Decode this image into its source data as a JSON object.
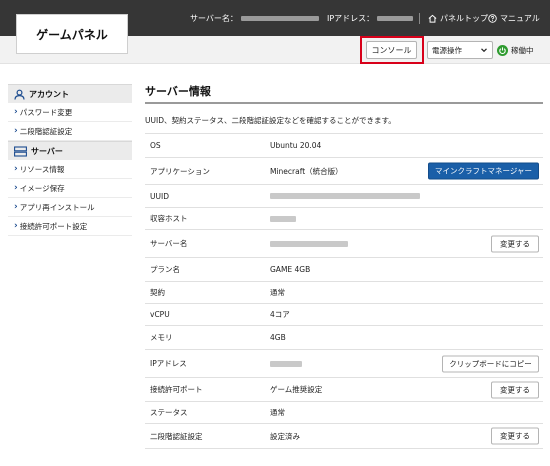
{
  "header": {
    "logo": "ゲームパネル",
    "server_name_label": "サーバー名：",
    "ip_label": "IPアドレス：",
    "panel_top": "パネルトップ",
    "manual": "マニュアル"
  },
  "toolbar": {
    "console_label": "コンソール",
    "power_select_value": "電源操作",
    "status_label": "稼働中"
  },
  "sidebar": {
    "account_heading": "アカウント",
    "account_items": [
      "パスワード変更",
      "二段階認証設定"
    ],
    "server_heading": "サーバー",
    "server_items": [
      "リソース情報",
      "イメージ保存",
      "アプリ再インストール",
      "接続許可ポート設定"
    ]
  },
  "main": {
    "title": "サーバー情報",
    "description": "UUID、契約ステータス、二段階認証設定などを確認することができます。",
    "rows": [
      {
        "label": "OS",
        "value": "Ubuntu 20.04"
      },
      {
        "label": "アプリケーション",
        "value": "Minecraft（統合版）",
        "button": "マインクラフトマネージャー"
      },
      {
        "label": "UUID",
        "value": ""
      },
      {
        "label": "収容ホスト",
        "value": ""
      },
      {
        "label": "サーバー名",
        "value": "",
        "button": "変更する"
      },
      {
        "label": "プラン名",
        "value": "GAME 4GB"
      },
      {
        "label": "契約",
        "value": "通常"
      },
      {
        "label": "vCPU",
        "value": "4コア"
      },
      {
        "label": "メモリ",
        "value": "4GB"
      },
      {
        "label": "IPアドレス",
        "value": "",
        "button": "クリップボードにコピー"
      },
      {
        "label": "接続許可ポート",
        "value": "ゲーム推奨設定",
        "button": "変更する"
      },
      {
        "label": "ステータス",
        "value": "通常"
      },
      {
        "label": "二段階認証設定",
        "value": "設定済み",
        "button": "変更する"
      }
    ]
  },
  "colors": {
    "topbar": "#363636",
    "highlight": "#d8001a",
    "primary_button": "#1a5fa8",
    "status_green": "#2e9b2f"
  }
}
